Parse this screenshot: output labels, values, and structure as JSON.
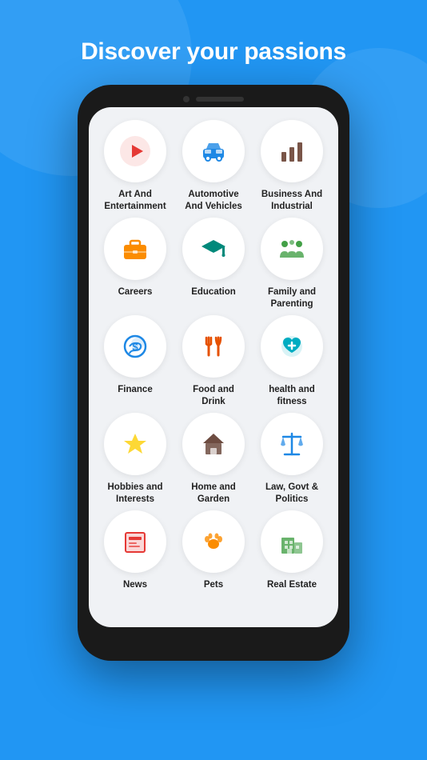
{
  "header": {
    "title": "Discover your passions"
  },
  "categories": [
    {
      "id": "art-entertainment",
      "label": "Art And Entertainment",
      "icon": "play",
      "iconColor": "#e53935",
      "bgColor": "#fff"
    },
    {
      "id": "automotive",
      "label": "Automotive And Vehicles",
      "icon": "car",
      "iconColor": "#1e88e5",
      "bgColor": "#fff"
    },
    {
      "id": "business",
      "label": "Business And Industrial",
      "icon": "chart",
      "iconColor": "#795548",
      "bgColor": "#fff"
    },
    {
      "id": "careers",
      "label": "Careers",
      "icon": "briefcase",
      "iconColor": "#fb8c00",
      "bgColor": "#fff"
    },
    {
      "id": "education",
      "label": "Education",
      "icon": "graduation",
      "iconColor": "#00897b",
      "bgColor": "#fff"
    },
    {
      "id": "family",
      "label": "Family and Parenting",
      "icon": "family",
      "iconColor": "#43a047",
      "bgColor": "#fff"
    },
    {
      "id": "finance",
      "label": "Finance",
      "icon": "money",
      "iconColor": "#1e88e5",
      "bgColor": "#fff"
    },
    {
      "id": "food",
      "label": "Food and Drink",
      "icon": "fork",
      "iconColor": "#e65100",
      "bgColor": "#fff"
    },
    {
      "id": "health",
      "label": "health and fitness",
      "icon": "heart",
      "iconColor": "#00acc1",
      "bgColor": "#fff"
    },
    {
      "id": "hobbies",
      "label": "Hobbies and Interests",
      "icon": "star",
      "iconColor": "#fdd835",
      "bgColor": "#fff"
    },
    {
      "id": "home",
      "label": "Home and Garden",
      "icon": "house",
      "iconColor": "#6d4c41",
      "bgColor": "#fff"
    },
    {
      "id": "law",
      "label": "Law, Govt & Politics",
      "icon": "scale",
      "iconColor": "#1e88e5",
      "bgColor": "#fff"
    },
    {
      "id": "news",
      "label": "News",
      "icon": "newspaper",
      "iconColor": "#e53935",
      "bgColor": "#fff"
    },
    {
      "id": "pets",
      "label": "Pets",
      "icon": "paw",
      "iconColor": "#fb8c00",
      "bgColor": "#fff"
    },
    {
      "id": "realestate",
      "label": "Real Estate",
      "icon": "building",
      "iconColor": "#43a047",
      "bgColor": "#fff"
    }
  ]
}
